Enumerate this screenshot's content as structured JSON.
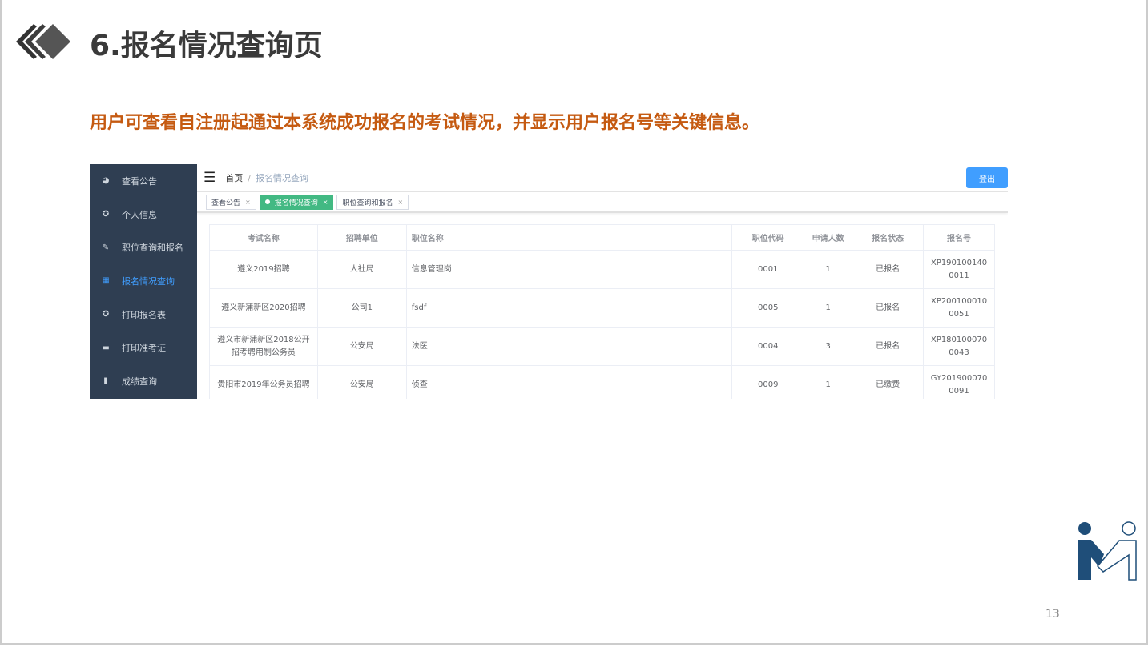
{
  "slide": {
    "title": "6.报名情况查询页",
    "subtitle": "用户可查看自注册起通过本系统成功报名的考试情况，并显示用户报名号等关键信息。",
    "page_number": "13"
  },
  "sidebar": {
    "items": [
      {
        "label": "查看公告",
        "icon": "dashboard-icon"
      },
      {
        "label": "个人信息",
        "icon": "lifebuoy-icon"
      },
      {
        "label": "职位查询和报名",
        "icon": "edit-icon"
      },
      {
        "label": "报名情况查询",
        "icon": "grid-icon",
        "active": true
      },
      {
        "label": "打印报名表",
        "icon": "lifebuoy-icon"
      },
      {
        "label": "打印准考证",
        "icon": "card-icon"
      },
      {
        "label": "成绩查询",
        "icon": "book-icon"
      }
    ]
  },
  "topbar": {
    "breadcrumb_home": "首页",
    "breadcrumb_sep": "/",
    "breadcrumb_current": "报名情况查询",
    "logout": "登出"
  },
  "tabs": [
    {
      "label": "查看公告"
    },
    {
      "label": "报名情况查询",
      "active": true
    },
    {
      "label": "职位查询和报名"
    }
  ],
  "tab_close": "×",
  "table": {
    "headers": [
      "考试名称",
      "招聘单位",
      "职位名称",
      "职位代码",
      "申请人数",
      "报名状态",
      "报名号"
    ],
    "rows": [
      [
        "遵义2019招聘",
        "人社局",
        "信息管理岗",
        "0001",
        "1",
        "已报名",
        "XP1901001400011"
      ],
      [
        "遵义新蒲新区2020招聘",
        "公司1",
        "fsdf",
        "0005",
        "1",
        "已报名",
        "XP2001000100051"
      ],
      [
        "遵义市新蒲新区2018公开招考聘用制公务员",
        "公安局",
        "法医",
        "0004",
        "3",
        "已报名",
        "XP1801000700043"
      ],
      [
        "贵阳市2019年公务员招聘",
        "公安局",
        "侦查",
        "0009",
        "1",
        "已缴费",
        "GY2019000700091"
      ]
    ]
  },
  "colors": {
    "accent": "#c55a11",
    "sidebar": "#2f3e52",
    "active_tab": "#42b983",
    "button": "#409eff",
    "brand": "#1f4e79"
  }
}
